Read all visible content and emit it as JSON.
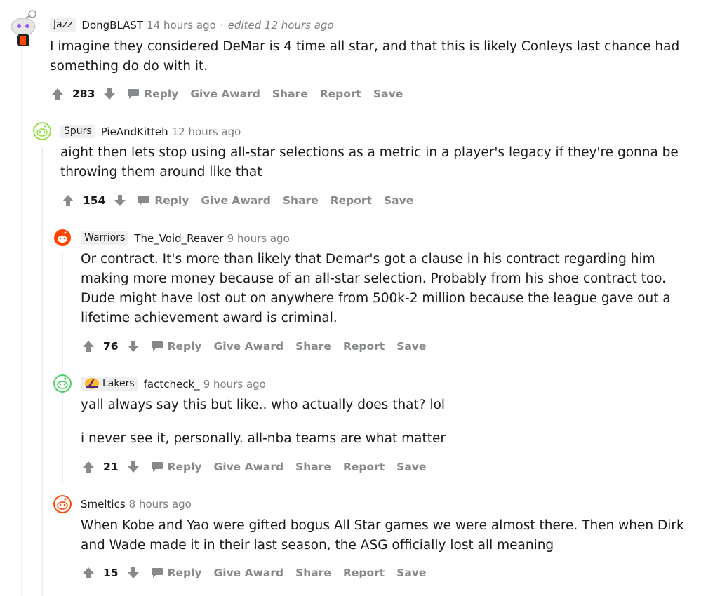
{
  "actions": {
    "reply": "Reply",
    "give_award": "Give Award",
    "share": "Share",
    "report": "Report",
    "save": "Save"
  },
  "comments": [
    {
      "flair": "Jazz",
      "author": "DongBLAST",
      "time": "14 hours ago",
      "edited": "edited 12 hours ago",
      "body": [
        "I imagine they considered DeMar is 4 time all star, and that this is likely Conleys last chance had something do do with it."
      ],
      "score": "283"
    },
    {
      "flair": "Spurs",
      "author": "PieAndKitteh",
      "time": "12 hours ago",
      "body": [
        "aight then lets stop using all-star selections as a metric in a player's legacy if they're gonna be throwing them around like that"
      ],
      "score": "154"
    },
    {
      "flair": "Warriors",
      "author": "The_Void_Reaver",
      "time": "9 hours ago",
      "body": [
        "Or contract. It's more than likely that Demar's got a clause in his contract regarding him making more money because of an all-star selection. Probably from his shoe contract too. Dude might have lost out on anywhere from 500k-2 million because the league gave out a lifetime achievement award is criminal."
      ],
      "score": "76"
    },
    {
      "flair": "Lakers",
      "author": "factcheck_",
      "time": "9 hours ago",
      "body": [
        "yall always say this but like.. who actually does that? lol",
        "i never see it, personally. all-nba teams are what matter"
      ],
      "score": "21"
    },
    {
      "author": "Smeltics",
      "time": "8 hours ago",
      "body": [
        "When Kobe and Yao were gifted bogus All Star games we were almost there. Then when Dirk and Wade made it in their last season, the ASG officially lost all meaning"
      ],
      "score": "15"
    }
  ],
  "colors": {
    "action_gray": "#878a8c",
    "snoo_red": "#ff4500",
    "snoo_green": "#46d160",
    "thread_line": "#edeff1"
  }
}
